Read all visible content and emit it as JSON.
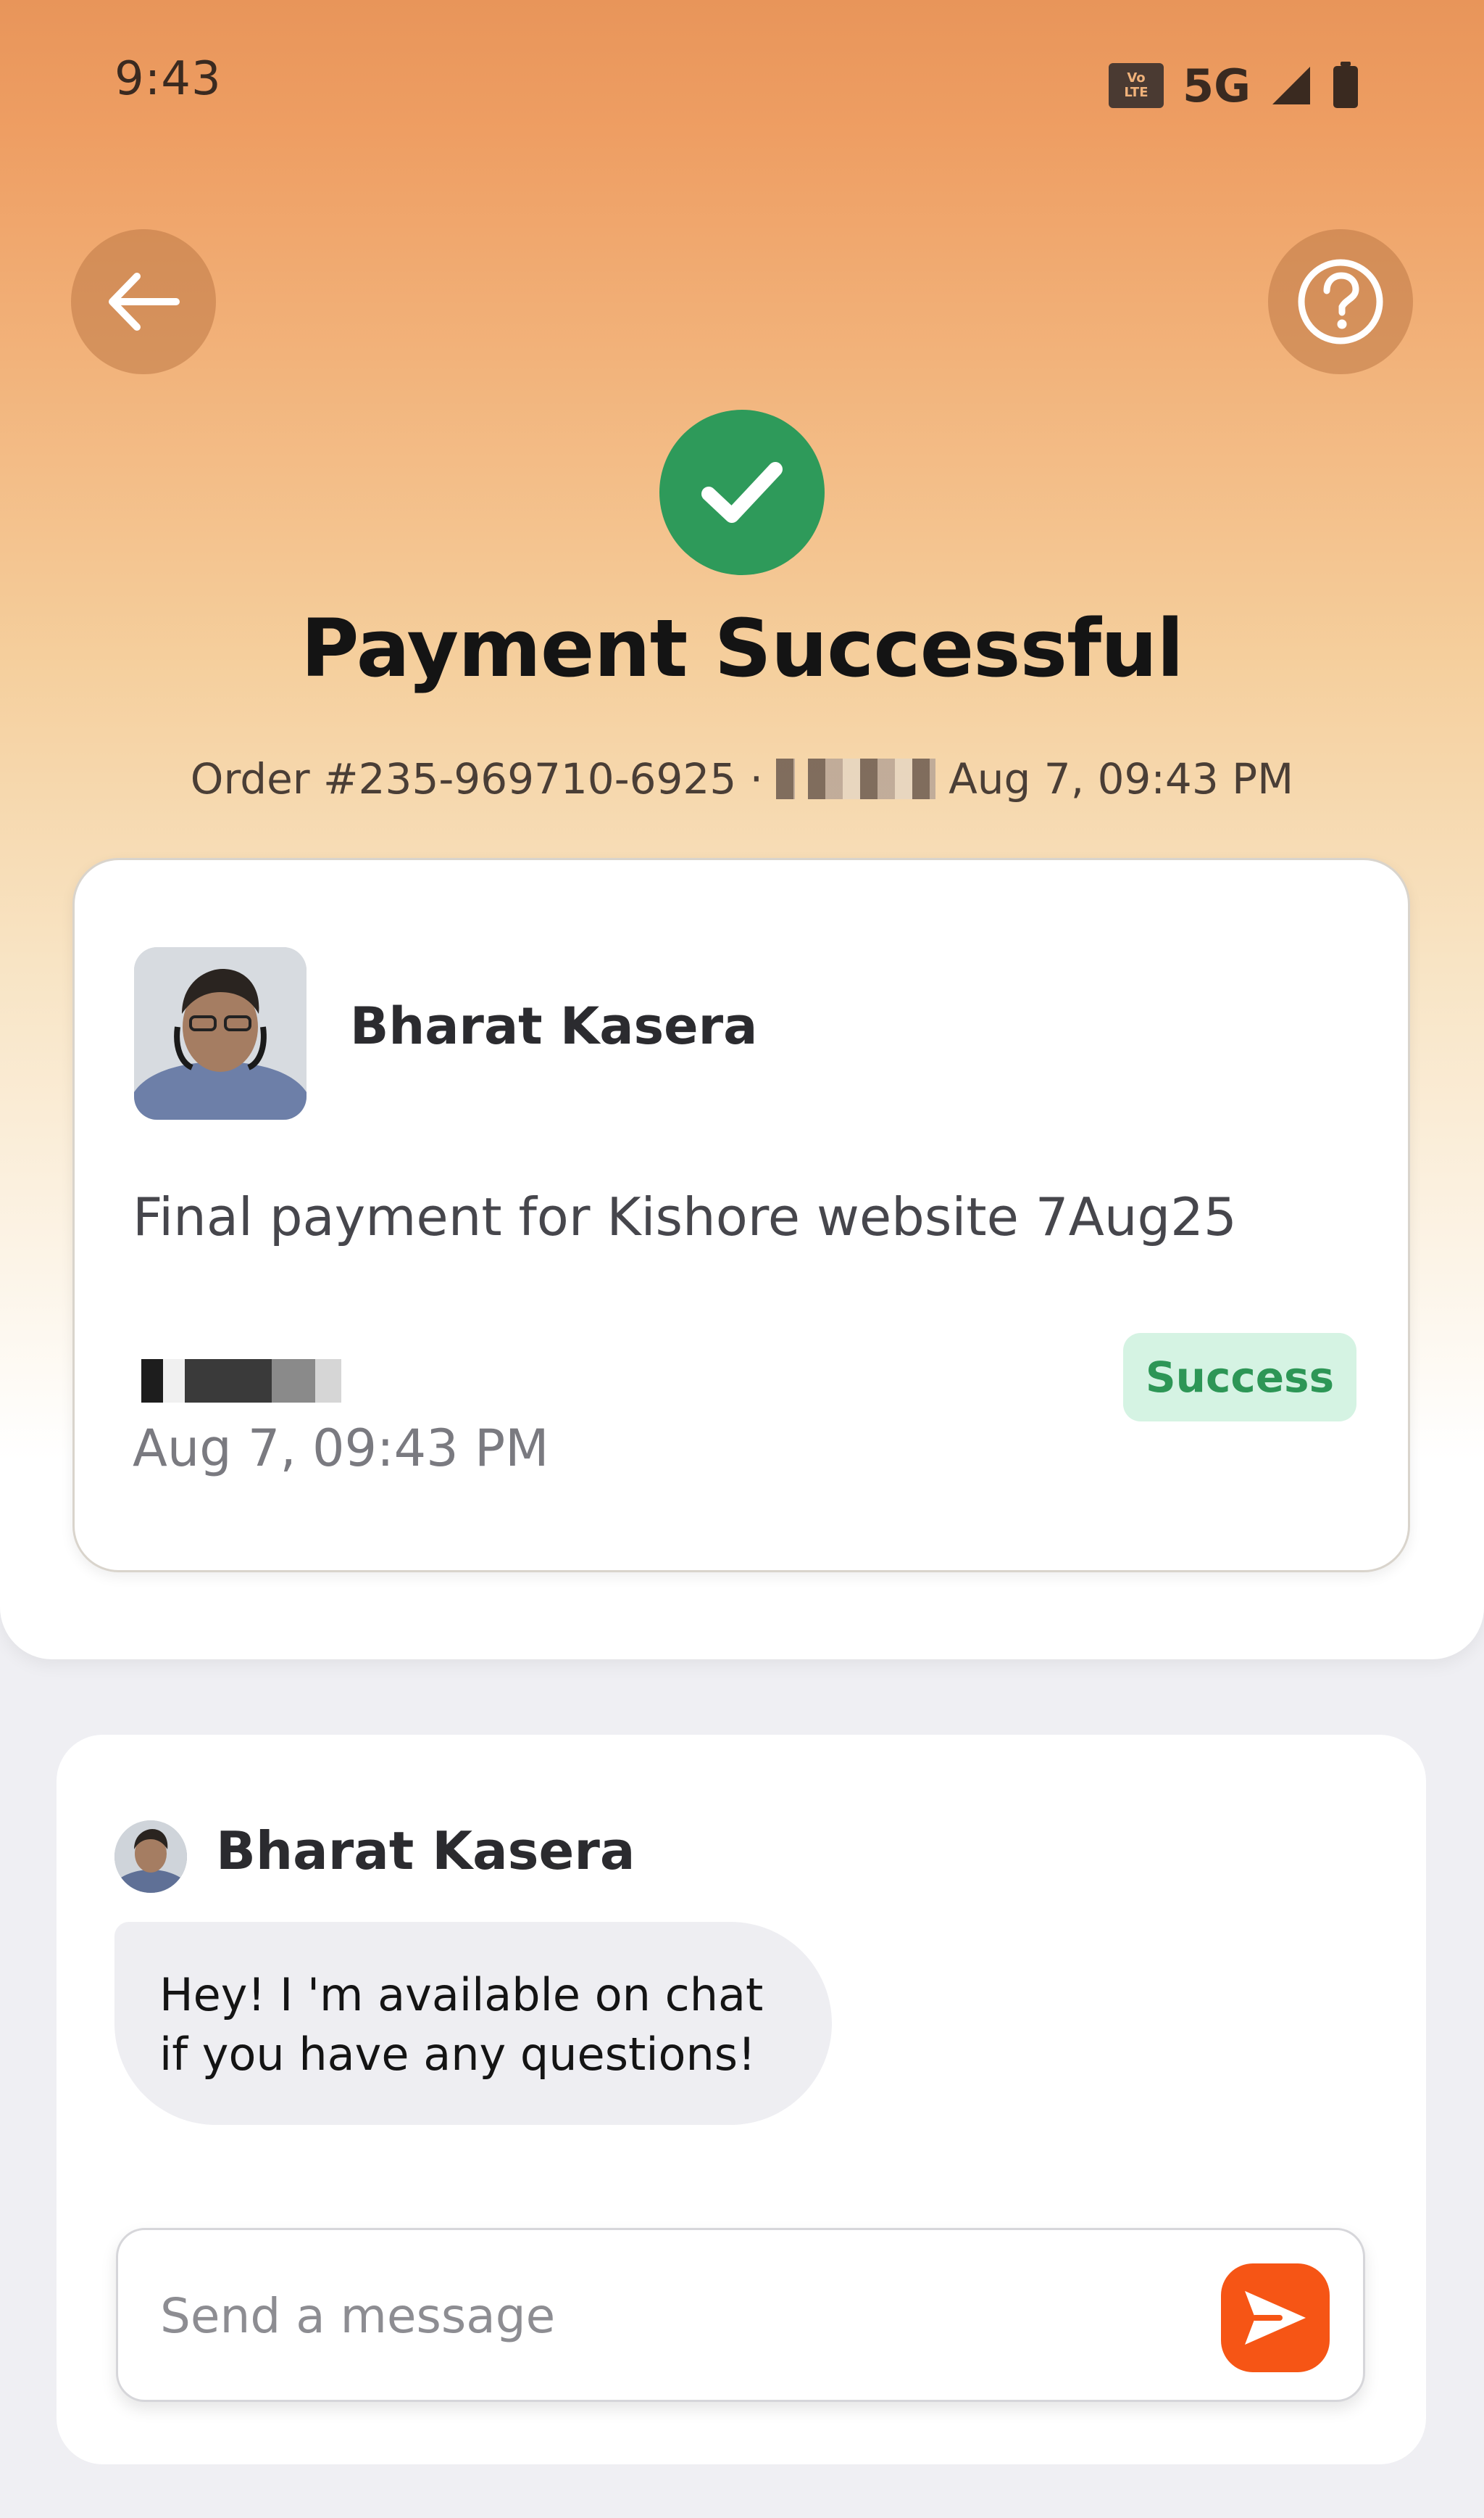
{
  "status_bar": {
    "time": "9:43",
    "volte_top": "Vo",
    "volte_bottom": "LTE",
    "network": "5G",
    "icons": [
      "volte-icon",
      "signal-icon",
      "battery-icon"
    ]
  },
  "header": {
    "back_icon": "arrow-left-icon",
    "help_icon": "question-circle-icon",
    "success_icon": "checkmark-icon",
    "title": "Payment Successful",
    "order_number": "Order #235-969710-6925 ·",
    "order_datetime": "Aug 7, 09:43 PM"
  },
  "payment_card": {
    "recipient_name": "Bharat Kasera",
    "description": "Final payment for Kishore website 7Aug25",
    "timestamp": "Aug 7, 09:43 PM",
    "status": "Success"
  },
  "chat": {
    "sender_name": "Bharat Kasera",
    "message": "Hey! I 'm available on chat if you have any questions!",
    "input_placeholder": "Send a message",
    "send_icon": "send-icon"
  },
  "colors": {
    "success_green": "#2e9a5a",
    "badge_bg": "#d5f3e3",
    "send_orange": "#f65515",
    "gradient_top": "#e8955a"
  }
}
